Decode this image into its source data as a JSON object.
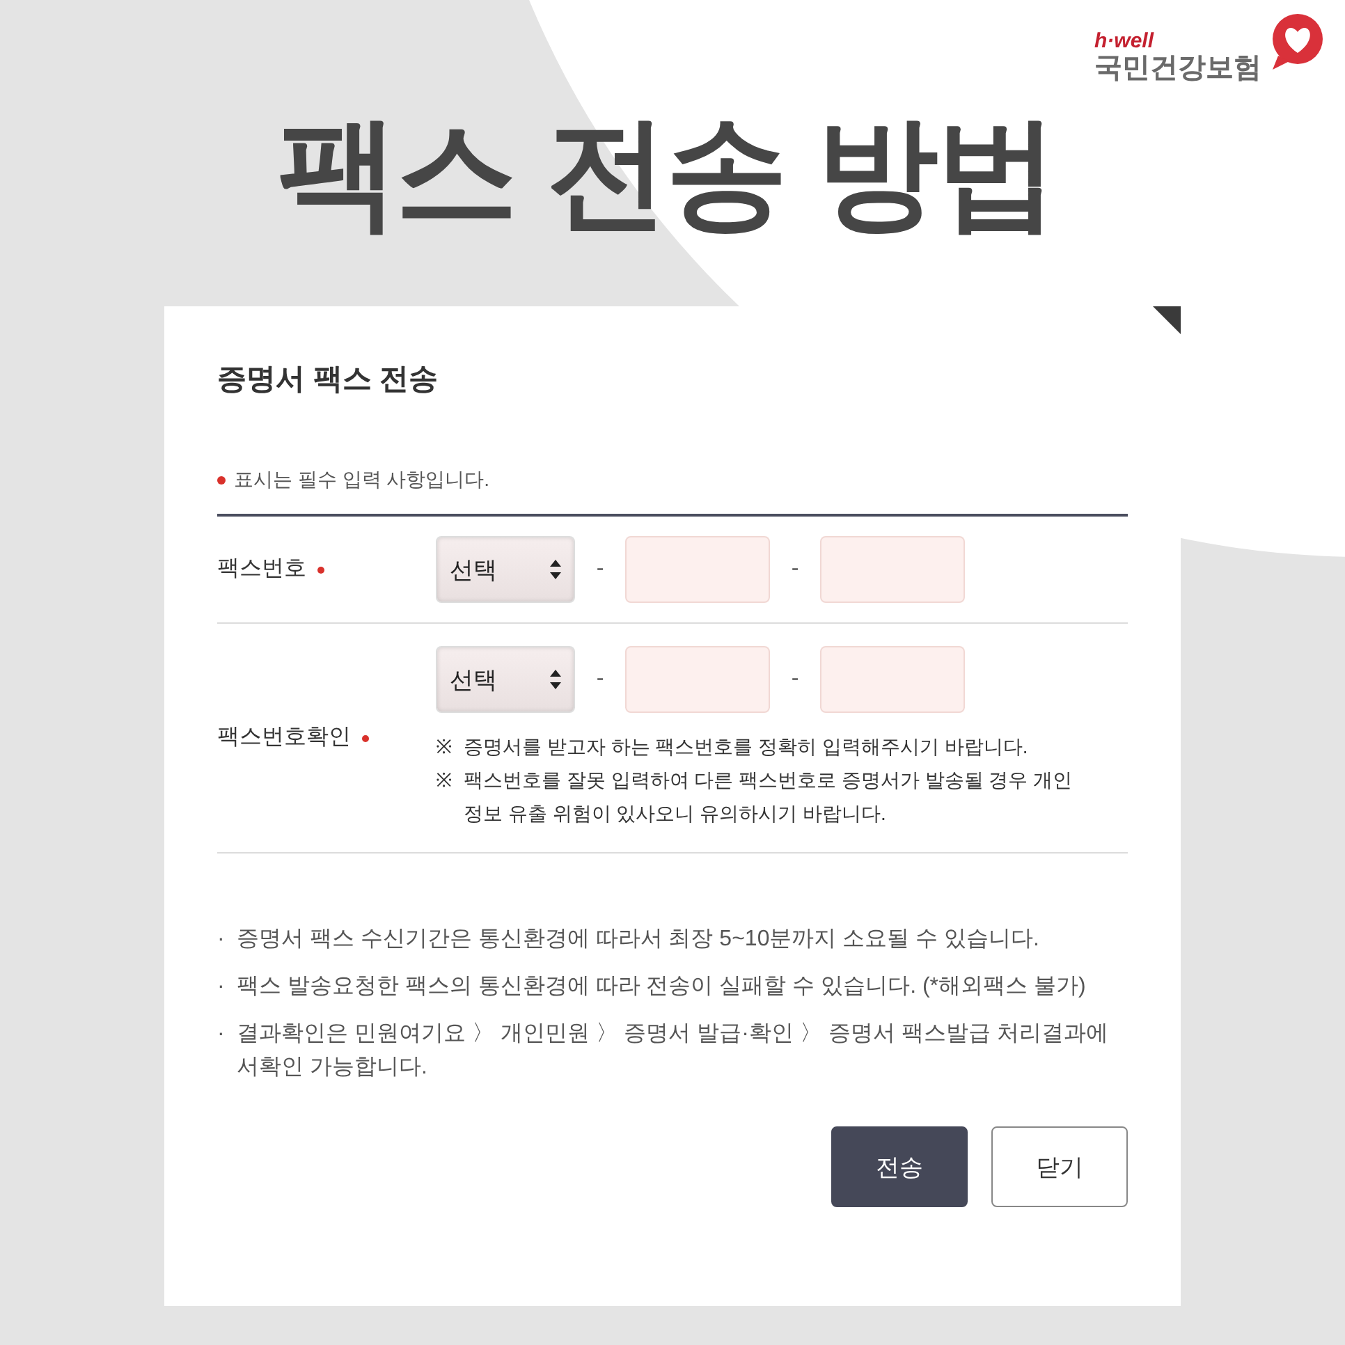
{
  "logo": {
    "brand": "h·well",
    "name": "국민건강보험"
  },
  "headline": "팩스 전송 방법",
  "dialog": {
    "title": "증명서 팩스 전송",
    "required_note": "표시는 필수 입력 사항입니다.",
    "rows": [
      {
        "label": "팩스번호",
        "required": true,
        "select": "선택",
        "separators": [
          "-",
          "-"
        ]
      },
      {
        "label": "팩스번호확인",
        "required": true,
        "select": "선택",
        "separators": [
          "-",
          "-"
        ],
        "notes": [
          {
            "mark": "※",
            "text": "증명서를 받고자 하는 팩스번호를 정확히 입력해주시기 바랍니다."
          },
          {
            "mark": "※",
            "text": "팩스번호를 잘못 입력하여 다른 팩스번호로 증명서가 발송될 경우 개인 정보 유출 위험이 있사오니 유의하시기 바랍니다."
          }
        ]
      }
    ],
    "notices": [
      {
        "bullet": "·",
        "text": "증명서 팩스 수신기간은 통신환경에 따라서 최장 5~10분까지 소요될 수 있습니다."
      },
      {
        "bullet": "·",
        "text": "팩스 발송요청한 팩스의 통신환경에 따라 전송이 실패할 수 있습니다. (*해외팩스 불가)"
      },
      {
        "bullet": "·",
        "text": "결과확인은 민원여기요 〉 개인민원 〉 증명서 발급·확인 〉 증명서 팩스발급 처리결과에서확인 가능합니다."
      }
    ],
    "buttons": [
      {
        "label": "전송",
        "kind": "primary"
      },
      {
        "label": "닫기",
        "kind": "secondary"
      }
    ]
  }
}
